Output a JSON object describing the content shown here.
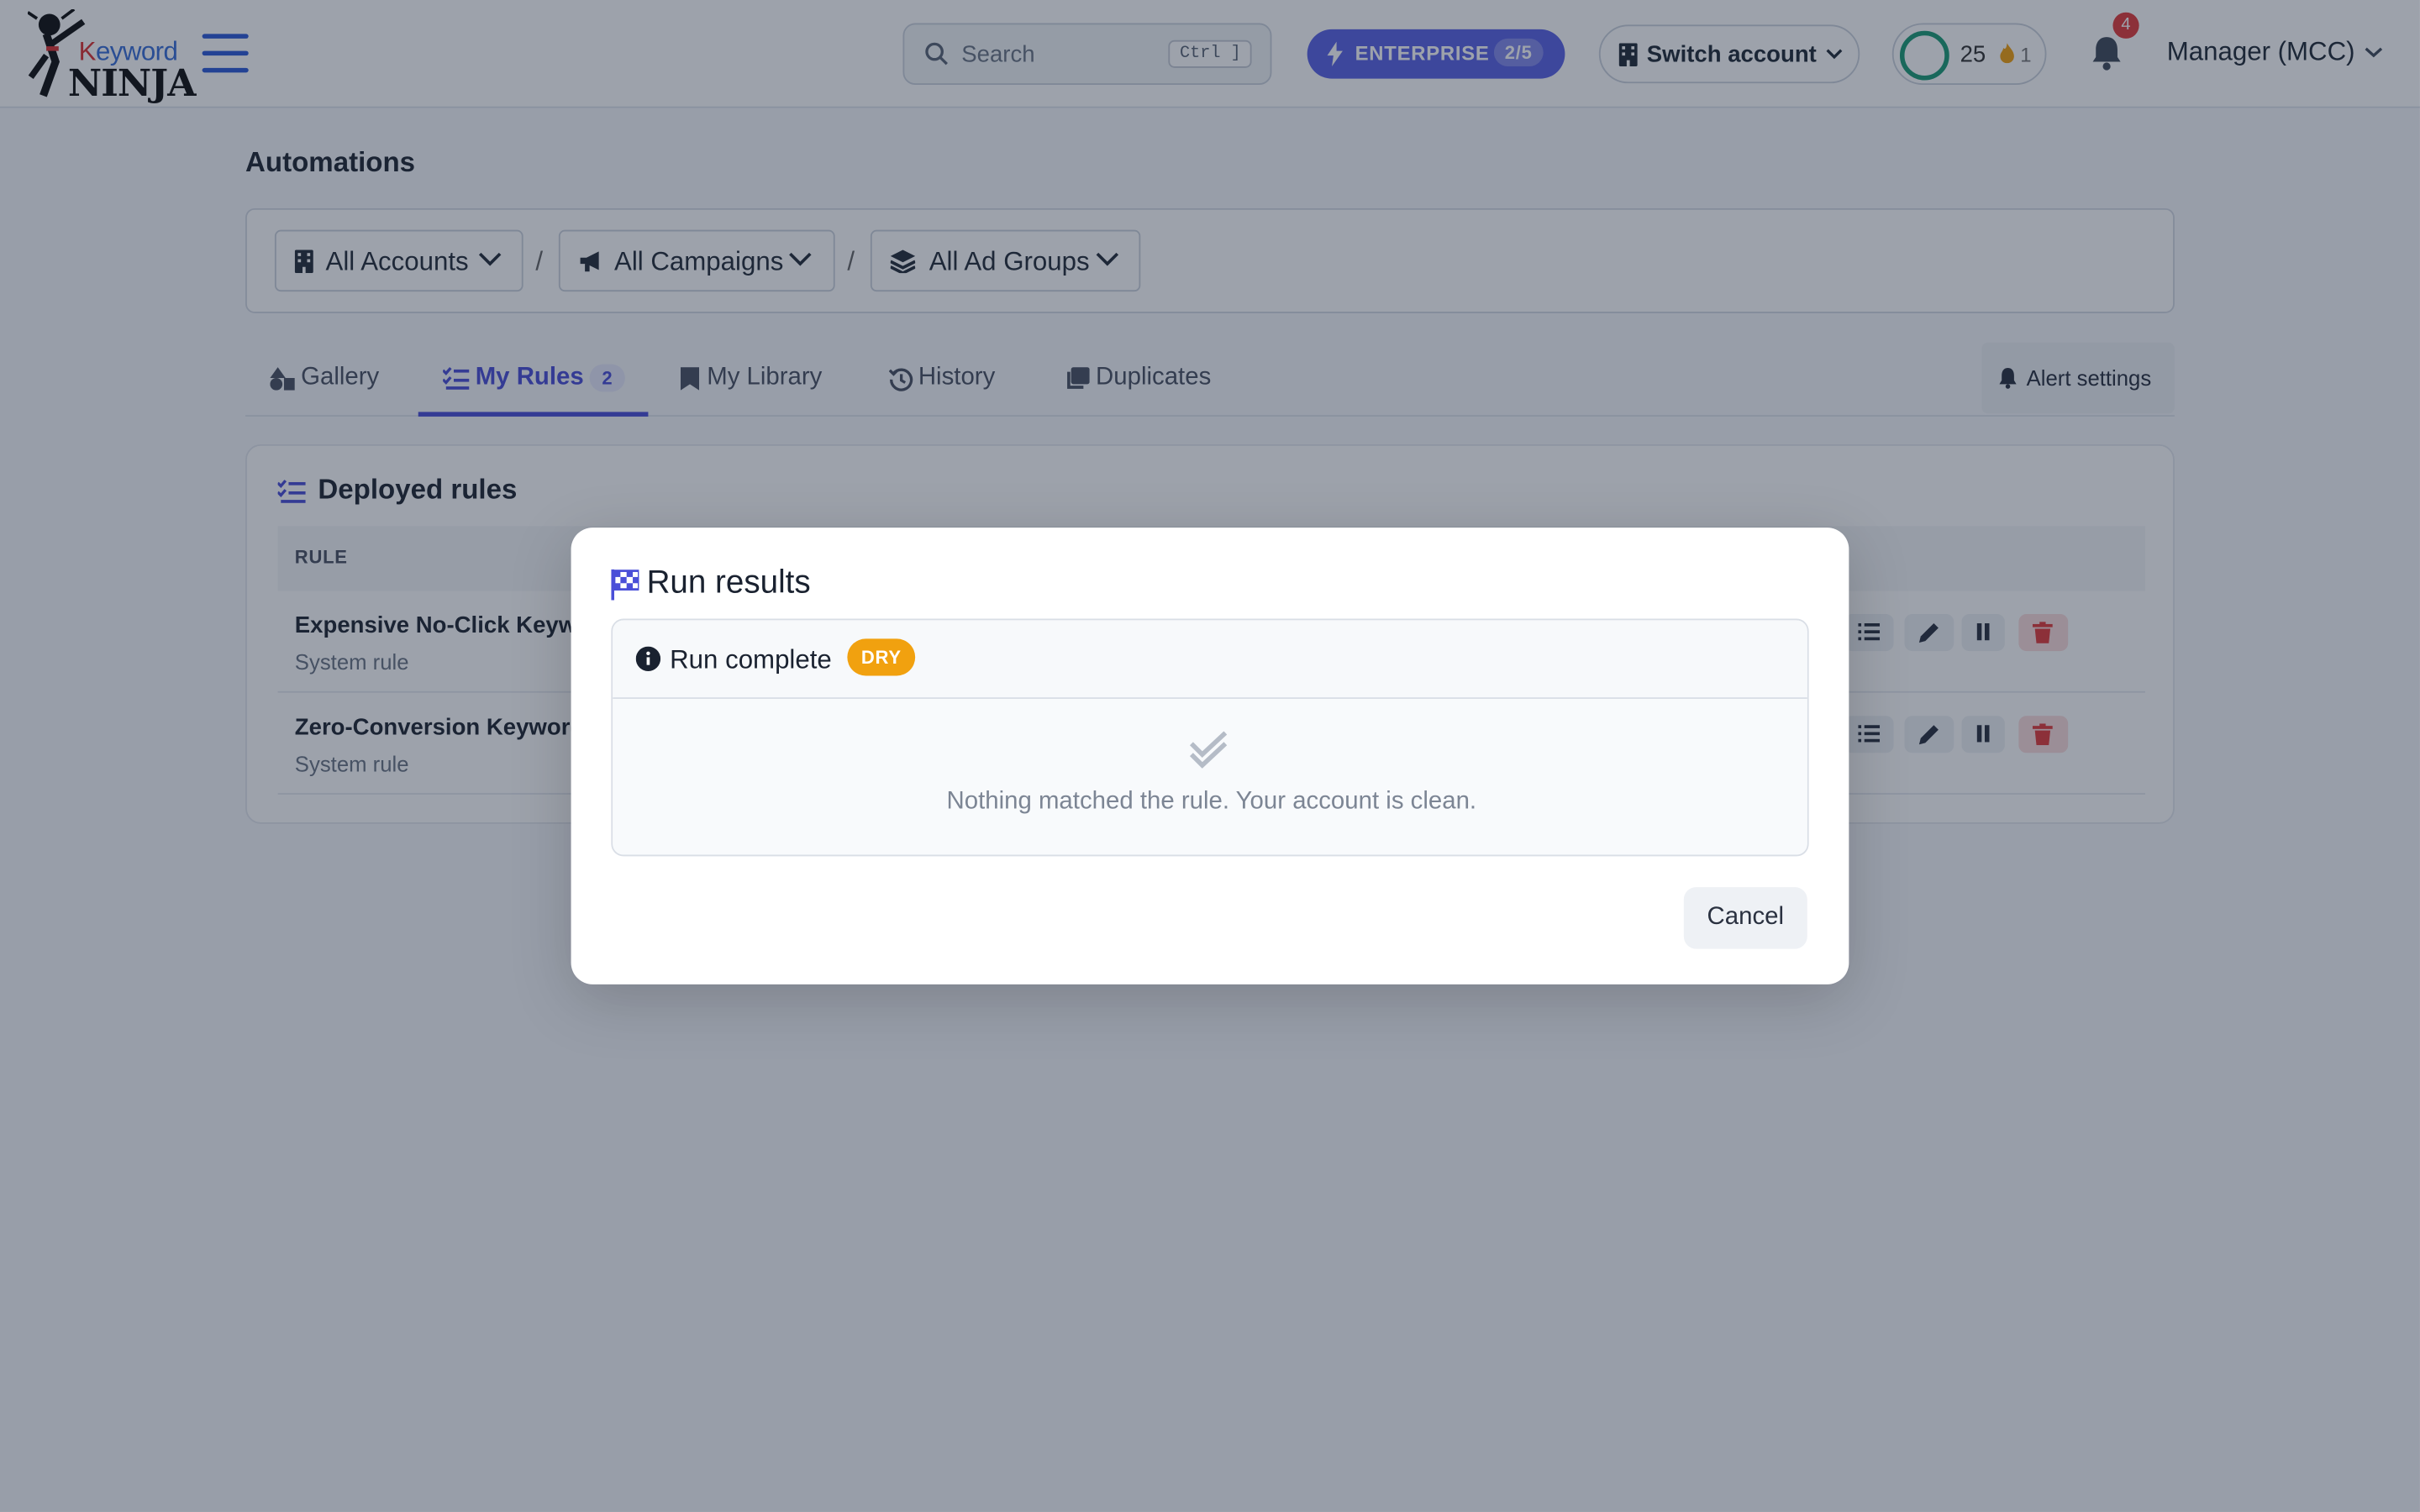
{
  "brand": {
    "logo_word": "Keyword",
    "logo_ninja": "NINJA"
  },
  "header": {
    "search_placeholder": "Search",
    "search_shortcut": "Ctrl ]",
    "plan_label": "ENTERPRISE",
    "plan_count": "2/5",
    "switch_account": "Switch account",
    "credits": "25",
    "streak": "1",
    "notifications": "4",
    "user": "Manager (MCC)"
  },
  "page": {
    "title": "Automations",
    "filters": [
      "All Accounts",
      "All Campaigns",
      "All Ad Groups"
    ],
    "separator": "/"
  },
  "tabs": [
    {
      "label": "Gallery",
      "icon": "shapes-icon"
    },
    {
      "label": "My Rules",
      "icon": "list-check-icon",
      "badge": "2",
      "active": true
    },
    {
      "label": "My Library",
      "icon": "bookmark-icon"
    },
    {
      "label": "History",
      "icon": "history-icon"
    },
    {
      "label": "Duplicates",
      "icon": "copy-icon"
    }
  ],
  "alert_settings": "Alert settings",
  "rules": {
    "heading": "Deployed rules",
    "column_rule": "RULE",
    "rows": [
      {
        "name": "Expensive No-Click Keyw",
        "type": "System rule"
      },
      {
        "name": "Zero-Conversion Keyword",
        "type": "System rule"
      }
    ]
  },
  "modal": {
    "title": "Run results",
    "status": "Run complete",
    "mode_badge": "DRY",
    "message": "Nothing matched the rule. Your account is clean.",
    "cancel": "Cancel"
  },
  "colors": {
    "accent": "#4a4fd8",
    "enterprise": "#5b63e6",
    "dry_badge": "#f1a10f",
    "danger": "#e23b3b",
    "ring": "#1c9b76"
  }
}
